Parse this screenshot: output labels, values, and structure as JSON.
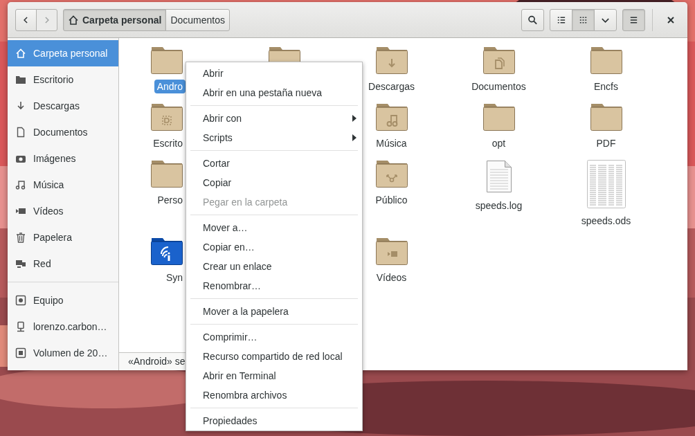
{
  "header": {
    "nav_buttons": [
      {
        "kind": "back",
        "disabled": false
      },
      {
        "kind": "forward",
        "disabled": true
      }
    ],
    "path": [
      {
        "label": "Carpeta personal",
        "kind": "home",
        "selected": true
      },
      {
        "label": "Documentos",
        "kind": "plain",
        "selected": false
      }
    ],
    "search_button": {
      "selected": false
    },
    "view_buttons": [
      {
        "kind": "list",
        "selected": false
      },
      {
        "kind": "grid",
        "selected": true
      },
      {
        "kind": "options",
        "selected": false
      }
    ],
    "menu_button": {
      "selected": true
    }
  },
  "sidebar": {
    "groups": [
      {
        "items": [
          {
            "label": "Carpeta personal",
            "kind": "home",
            "selected": true
          },
          {
            "label": "Escritorio",
            "kind": "desktop",
            "selected": false
          },
          {
            "label": "Descargas",
            "kind": "download",
            "selected": false
          },
          {
            "label": "Documentos",
            "kind": "document",
            "selected": false
          },
          {
            "label": "Imágenes",
            "kind": "camera",
            "selected": false
          },
          {
            "label": "Música",
            "kind": "music",
            "selected": false
          },
          {
            "label": "Vídeos",
            "kind": "video",
            "selected": false
          },
          {
            "label": "Papelera",
            "kind": "trash",
            "selected": false
          },
          {
            "label": "Red",
            "kind": "network",
            "selected": false
          }
        ]
      },
      {
        "items": [
          {
            "label": "Equipo",
            "kind": "computer",
            "selected": false
          },
          {
            "label": "lorenzo.carbon…",
            "kind": "remote",
            "selected": false
          },
          {
            "label": "Volumen de 20…",
            "kind": "drive",
            "selected": false
          }
        ]
      }
    ]
  },
  "files": {
    "columns": [
      {
        "items": [
          {
            "label": "Andro",
            "kind": "folder",
            "selected": true
          },
          {
            "label": "Escrito",
            "kind": "desktop-folder",
            "selected": false
          },
          {
            "label": "Perso",
            "kind": "folder",
            "selected": false
          },
          {
            "label": "Syn",
            "kind": "wireless-folder",
            "selected": false
          }
        ]
      },
      {
        "items": [
          {
            "kind": "folder",
            "selected": false
          }
        ]
      },
      {
        "items": [
          {
            "label": "Descargas",
            "kind": "download-folder",
            "selected": false
          },
          {
            "label": "Música",
            "kind": "music-folder",
            "selected": false
          },
          {
            "label": "Público",
            "kind": "share-folder",
            "selected": false
          },
          {
            "label": "Vídeos",
            "kind": "video-folder",
            "selected": false
          }
        ]
      },
      {
        "items": [
          {
            "label": "Documentos",
            "kind": "documents-folder",
            "selected": false
          },
          {
            "label": "opt",
            "kind": "folder",
            "selected": false
          },
          {
            "label": "speeds.log",
            "kind": "text-file",
            "selected": false
          }
        ]
      },
      {
        "items": [
          {
            "label": "Encfs",
            "kind": "folder",
            "selected": false
          },
          {
            "label": "PDF",
            "kind": "folder",
            "selected": false
          },
          {
            "label": "speeds.ods",
            "kind": "spreadsheet-file",
            "selected": false
          }
        ]
      }
    ]
  },
  "status_bar": {
    "text": "«Android» se"
  },
  "menu": {
    "groups": [
      {
        "items": [
          {
            "label": "Abrir",
            "disabled": false,
            "submenu": false
          },
          {
            "label": "Abrir en una pestaña nueva",
            "disabled": false,
            "submenu": false
          }
        ]
      },
      {
        "items": [
          {
            "label": "Abrir con",
            "disabled": false,
            "submenu": true
          },
          {
            "label": "Scripts",
            "disabled": false,
            "submenu": true
          }
        ]
      },
      {
        "items": [
          {
            "label": "Cortar",
            "disabled": false,
            "submenu": false
          },
          {
            "label": "Copiar",
            "disabled": false,
            "submenu": false
          },
          {
            "label": "Pegar en la carpeta",
            "disabled": true,
            "submenu": false
          }
        ]
      },
      {
        "items": [
          {
            "label": "Mover a…",
            "disabled": false,
            "submenu": false
          },
          {
            "label": "Copiar en…",
            "disabled": false,
            "submenu": false
          },
          {
            "label": "Crear un enlace",
            "disabled": false,
            "submenu": false
          },
          {
            "label": "Renombrar…",
            "disabled": false,
            "submenu": false
          }
        ]
      },
      {
        "items": [
          {
            "label": "Mover a la papelera",
            "disabled": false,
            "submenu": false
          }
        ]
      },
      {
        "items": [
          {
            "label": "Comprimir…",
            "disabled": false,
            "submenu": false
          },
          {
            "label": "Recurso compartido de red local",
            "disabled": false,
            "submenu": false
          },
          {
            "label": "Abrir en Terminal",
            "disabled": false,
            "submenu": false
          },
          {
            "label": "Renombra archivos",
            "disabled": false,
            "submenu": false
          }
        ]
      },
      {
        "items": [
          {
            "label": "Propiedades",
            "disabled": false,
            "submenu": false
          }
        ]
      }
    ]
  }
}
